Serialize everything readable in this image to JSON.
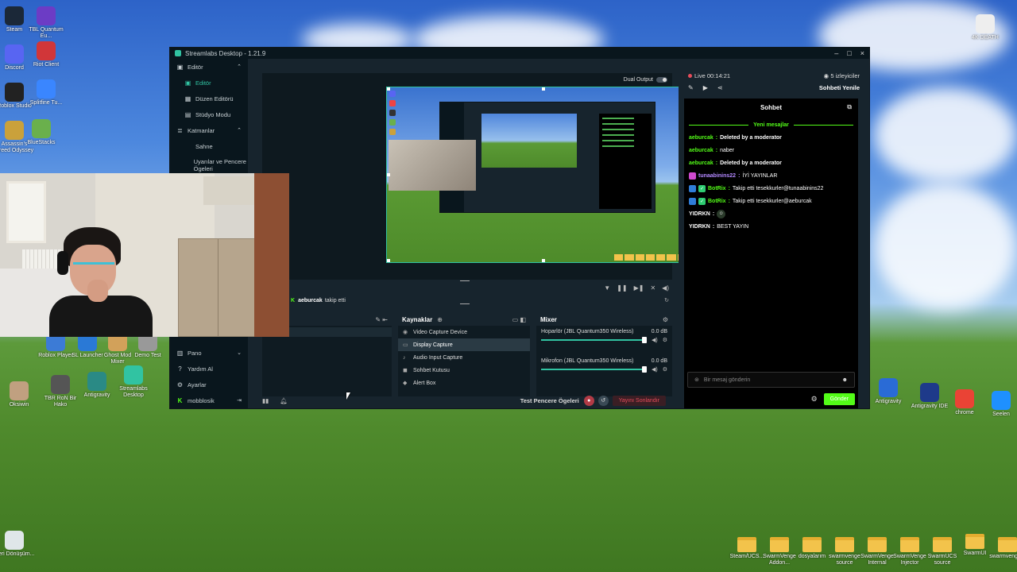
{
  "desktop": {
    "left_icons": [
      {
        "label": "Steam",
        "icon": "steam-icon",
        "color": "#1b2838"
      },
      {
        "label": "TBL Quantum Eu...",
        "icon": "app-icon",
        "color": "#6c3cc5"
      },
      {
        "label": "Discord",
        "icon": "discord-icon",
        "color": "#5865f2"
      },
      {
        "label": "Riot Client",
        "icon": "riot-icon",
        "color": "#d13639"
      },
      {
        "label": "Roblox Studio",
        "icon": "roblox-icon",
        "color": "#222222"
      },
      {
        "label": "Splitfine Tu...",
        "icon": "app-icon",
        "color": "#3a86ff"
      },
      {
        "label": "Assassin's Creed Odyssey",
        "icon": "game-icon",
        "color": "#caa13b"
      },
      {
        "label": "BlueStacks",
        "icon": "bluestacks-icon",
        "color": "#6ab04c"
      }
    ],
    "middle_icons": [
      {
        "label": "Geri Dönüşüm...",
        "icon": "recycle-bin-icon",
        "color": "#dfe6e9"
      },
      {
        "label": "Roblox Player",
        "icon": "roblox-icon",
        "color": "#3c7bd6"
      },
      {
        "label": "SL Launcher",
        "icon": "app-icon",
        "color": "#2a79d6"
      },
      {
        "label": "Ghost Mod Mixer",
        "icon": "app-icon",
        "color": "#d2a15a"
      },
      {
        "label": "Demo Test",
        "icon": "app-icon",
        "color": "#999999"
      },
      {
        "label": "Oksiwin",
        "icon": "app-icon",
        "color": "#c0a080"
      },
      {
        "label": "TBR RoN Bir Hako",
        "icon": "app-icon",
        "color": "#555555"
      },
      {
        "label": "Antigravity",
        "icon": "antigravity-icon",
        "color": "#2a8a85"
      },
      {
        "label": "Streamlabs Desktop",
        "icon": "streamlabs-icon",
        "color": "#31c3a2"
      }
    ],
    "right_icons": [
      {
        "label": "4K DEATH",
        "icon": "app-icon",
        "color": "#eeeeee"
      },
      {
        "label": "Antigravity",
        "icon": "antigravity-icon",
        "color": "#2a6bd6"
      },
      {
        "label": "Antigravity IDE",
        "icon": "antigravity-icon",
        "color": "#1e3a8a"
      },
      {
        "label": "chrome",
        "icon": "chrome-icon",
        "color": "#ea4335"
      },
      {
        "label": "Seelen",
        "icon": "app-icon",
        "color": "#1e90ff"
      }
    ],
    "bottom_folders": [
      {
        "label": "Steam/UCS..."
      },
      {
        "label": "SwarmVenge Addon..."
      },
      {
        "label": "dosyalarım"
      },
      {
        "label": "swarmvenge source"
      },
      {
        "label": "SwarmVenge Internal"
      },
      {
        "label": "SwarmVenge Injector"
      },
      {
        "label": "SwarmUCS source"
      },
      {
        "label": "SwarmUI"
      },
      {
        "label": "swarmvenge..."
      }
    ]
  },
  "window": {
    "title": "Streamlabs Desktop - 1.21.9",
    "controls": [
      "–",
      "□",
      "×"
    ]
  },
  "nav": {
    "items": [
      {
        "label": "Editör",
        "icon": "editor-icon",
        "level": "top",
        "chevron": "⌃"
      },
      {
        "label": "Editör",
        "icon": "editor-icon",
        "level": "sub",
        "active": true
      },
      {
        "label": "Düzen Editörü",
        "icon": "layout-icon",
        "level": "sub"
      },
      {
        "label": "Stüdyo Modu",
        "icon": "studio-icon",
        "level": "sub"
      },
      {
        "label": "Katmanlar",
        "icon": "layers-icon",
        "level": "top",
        "chevron": "⌃"
      },
      {
        "label": "Sahne",
        "icon": "",
        "level": "sub"
      },
      {
        "label": "Uyarılar ve Pencere Ögeleri",
        "icon": "",
        "level": "sub"
      }
    ],
    "bottom_items": [
      {
        "label": "Pano",
        "icon": "dashboard-icon",
        "chevron": "⌄"
      },
      {
        "label": "Yardım Al",
        "icon": "help-icon"
      },
      {
        "label": "Ayarlar",
        "icon": "settings-icon"
      },
      {
        "label": "mobblosik",
        "icon": "kick-icon",
        "trailing": "⇥"
      }
    ]
  },
  "editor": {
    "dual_output_label": "Dual Output",
    "alert": {
      "user": "aeburcak",
      "text": "takip etti"
    }
  },
  "sources": {
    "title": "Kaynaklar",
    "items": [
      {
        "label": "Video Capture Device",
        "icon": "camera-icon"
      },
      {
        "label": "Display Capture",
        "icon": "monitor-icon",
        "selected": true
      },
      {
        "label": "Audio Input Capture",
        "icon": "mic-icon"
      },
      {
        "label": "Sohbet Kutusu",
        "icon": "chat-icon"
      },
      {
        "label": "Alert Box",
        "icon": "alert-icon"
      }
    ]
  },
  "mixer": {
    "title": "Mixer",
    "channels": [
      {
        "name": "Hoparlör (JBL Quantum350 Wireless)",
        "db": "0.0 dB",
        "level": 0.98
      },
      {
        "name": "Mikrofon (JBL Quantum350 Wireless)",
        "db": "0.0 dB",
        "level": 0.98
      }
    ]
  },
  "footer": {
    "test_label": "Test Pencere Ögeleri",
    "end_stream_label": "Yayını Sonlandır"
  },
  "chat": {
    "live_label": "Live 00:14:21",
    "viewers_label": "5 izleyiciler",
    "refresh_label": "Sohbeti Yenile",
    "title": "Sohbet",
    "new_messages_label": "Yeni mesajlar",
    "messages": [
      {
        "user": "aeburcak",
        "text": "Deleted by a moderator",
        "user_color": "#53fc18",
        "badges": []
      },
      {
        "user": "aeburcak",
        "text": "naber",
        "user_color": "#53fc18",
        "badges": []
      },
      {
        "user": "aeburcak",
        "text": "Deleted by a moderator",
        "user_color": "#53fc18",
        "badges": []
      },
      {
        "user": "tunaabinins22",
        "text": "İYİ YAYINLAR",
        "user_color": "#b388ff",
        "badges": [
          "#d04ad0"
        ]
      },
      {
        "user": "BotRix",
        "text": "Takip etti tesekkurler@tunaabinins22",
        "user_color": "#53fc18",
        "badges": [
          "#2f7dd8",
          "#2ecc71"
        ]
      },
      {
        "user": "BotRix",
        "text": "Takip etti tesekkurler@aeburcak",
        "user_color": "#53fc18",
        "badges": [
          "#2f7dd8",
          "#2ecc71"
        ]
      },
      {
        "user": "YIDRKN",
        "text": "",
        "user_color": "#ffffff",
        "badges": [],
        "emote": true
      },
      {
        "user": "YIDRKN",
        "text": "BEST YAYIN",
        "user_color": "#ffffff",
        "badges": []
      }
    ],
    "input_placeholder": "Bir mesaj gönderin",
    "send_label": "Gönder"
  },
  "colors": {
    "accent": "#31c3a2",
    "kick_green": "#53fc18",
    "panel": "#17242d",
    "end_stream": "#e74c5a"
  }
}
